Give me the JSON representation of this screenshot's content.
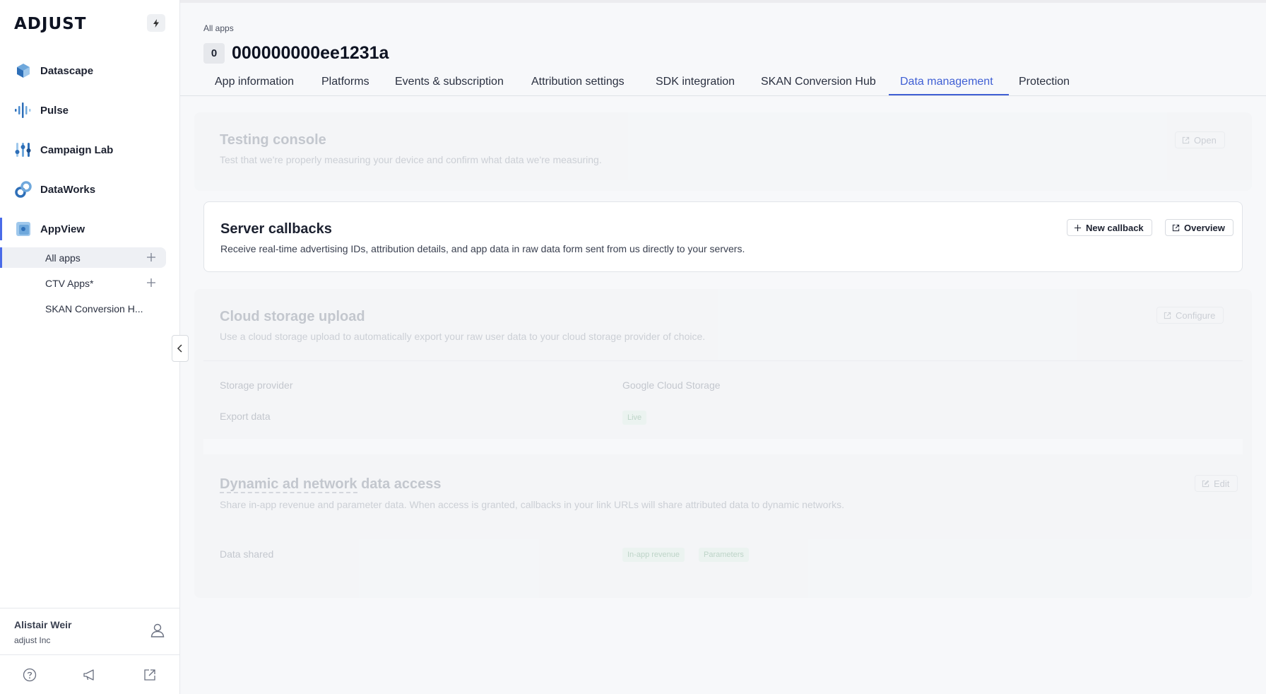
{
  "sidebar": {
    "logo": "ADJUST",
    "nav": [
      {
        "label": "Datascape"
      },
      {
        "label": "Pulse"
      },
      {
        "label": "Campaign Lab"
      },
      {
        "label": "DataWorks"
      },
      {
        "label": "AppView"
      }
    ],
    "sub_items": [
      {
        "label": "All apps"
      },
      {
        "label": "CTV Apps*"
      },
      {
        "label": "SKAN Conversion H..."
      }
    ],
    "user": {
      "name": "Alistair Weir",
      "org": "adjust Inc"
    }
  },
  "header": {
    "breadcrumb": "All apps",
    "badge": "0",
    "title": "000000000ee1231a"
  },
  "tabs": [
    {
      "label": "App information"
    },
    {
      "label": "Platforms"
    },
    {
      "label": "Events & subscription"
    },
    {
      "label": "Attribution settings"
    },
    {
      "label": "SDK integration"
    },
    {
      "label": "SKAN Conversion Hub"
    },
    {
      "label": "Data management",
      "active": true
    },
    {
      "label": "Protection"
    }
  ],
  "cards": {
    "testing_console": {
      "title": "Testing console",
      "desc": "Test that we're properly measuring your device and confirm what data we're measuring.",
      "button": "Open"
    },
    "server_callbacks": {
      "title": "Server callbacks",
      "desc": "Receive real-time advertising IDs, attribution details, and app data in raw data form sent from us directly to your servers.",
      "new_button": "New callback",
      "overview_button": "Overview"
    },
    "cloud_storage": {
      "title": "Cloud storage upload",
      "desc": "Use a cloud storage upload to automatically export your raw user data to your cloud storage provider of choice.",
      "button": "Configure",
      "storage_label": "Storage provider",
      "storage_value": "Google Cloud Storage",
      "export_label": "Export data",
      "export_value": "Live"
    },
    "dynamic_ad": {
      "title_part1": "Dynamic ad network",
      "title_part2": " data access",
      "desc": "Share in-app revenue and parameter data. When access is granted, callbacks in your link URLs will share attributed data to dynamic networks.",
      "button": "Edit",
      "shared_label": "Data shared",
      "chips": [
        "In-app revenue",
        "Parameters"
      ]
    }
  },
  "colors": {
    "accent": "#3f5fd4",
    "active_bar": "#4a6be8"
  }
}
